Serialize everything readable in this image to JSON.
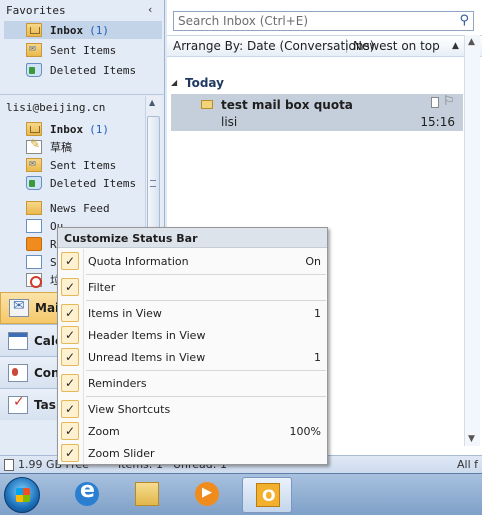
{
  "nav": {
    "favorites_header": "Favorites",
    "collapse_glyph": "‹",
    "favorites": [
      {
        "label": "Inbox",
        "count": "(1)",
        "bold": true,
        "selected": true
      },
      {
        "label": "Sent Items",
        "count": "",
        "bold": false,
        "selected": false
      },
      {
        "label": "Deleted Items",
        "count": "",
        "bold": false,
        "selected": false
      }
    ],
    "account_header": "lisi@beijing.cn",
    "account_folders": [
      {
        "label": "Inbox",
        "count": "(1)",
        "bold": true
      },
      {
        "label": "草稿",
        "count": "",
        "bold": false
      },
      {
        "label": "Sent Items",
        "count": "",
        "bold": false
      },
      {
        "label": "Deleted Items",
        "count": "",
        "bold": false
      },
      {
        "label": "News Feed",
        "count": "",
        "bold": false
      },
      {
        "label": "Ou",
        "count": "",
        "bold": false
      },
      {
        "label": "RS",
        "count": "",
        "bold": false
      },
      {
        "label": "S",
        "count": "",
        "bold": false
      },
      {
        "label": "垃",
        "count": "",
        "bold": false
      }
    ],
    "buttons": [
      {
        "label": "Mai",
        "icon": "mail-icon",
        "active": true
      },
      {
        "label": "Cale",
        "icon": "calendar-icon",
        "active": false
      },
      {
        "label": "Con",
        "icon": "contacts-icon",
        "active": false
      },
      {
        "label": "Tas",
        "icon": "tasks-icon",
        "active": false
      }
    ]
  },
  "list": {
    "search_placeholder": "Search Inbox (Ctrl+E)",
    "arrange_by": "Arrange By: Date (Conversations)",
    "sort": "Newest on top",
    "group": "Today",
    "message": {
      "subject": "test mail box quota",
      "sender": "lisi",
      "time": "15:16"
    }
  },
  "status_bar": {
    "quota": "1.99 GB Free",
    "items": "Items: 1",
    "unread": "Unread: 1",
    "right": "All f"
  },
  "context_menu": {
    "title": "Customize Status Bar",
    "items": [
      {
        "label": "Quota Information",
        "value": "On",
        "checked": true
      },
      {
        "label": "Filter",
        "value": "",
        "checked": true
      },
      {
        "label": "Items in View",
        "value": "1",
        "checked": true
      },
      {
        "label": "Header Items in View",
        "value": "",
        "checked": true
      },
      {
        "label": "Unread Items in View",
        "value": "1",
        "checked": true
      },
      {
        "label": "Reminders",
        "value": "",
        "checked": true
      },
      {
        "label": "View Shortcuts",
        "value": "",
        "checked": true
      },
      {
        "label": "Zoom",
        "value": "100%",
        "checked": true
      },
      {
        "label": "Zoom Slider",
        "value": "",
        "checked": true
      }
    ],
    "check_glyph": "✓"
  },
  "taskbar": {
    "apps": [
      "start-orb",
      "internet-explorer-icon",
      "windows-explorer-icon",
      "media-player-icon",
      "outlook-icon"
    ]
  },
  "colors": {
    "nav_selected": "#c3d3e8",
    "message_selected": "#c5cfdc",
    "menu_check_bg": "#fdf1cf",
    "nav_button_active": "#f5c869",
    "count_blue": "#1f5fbf"
  }
}
